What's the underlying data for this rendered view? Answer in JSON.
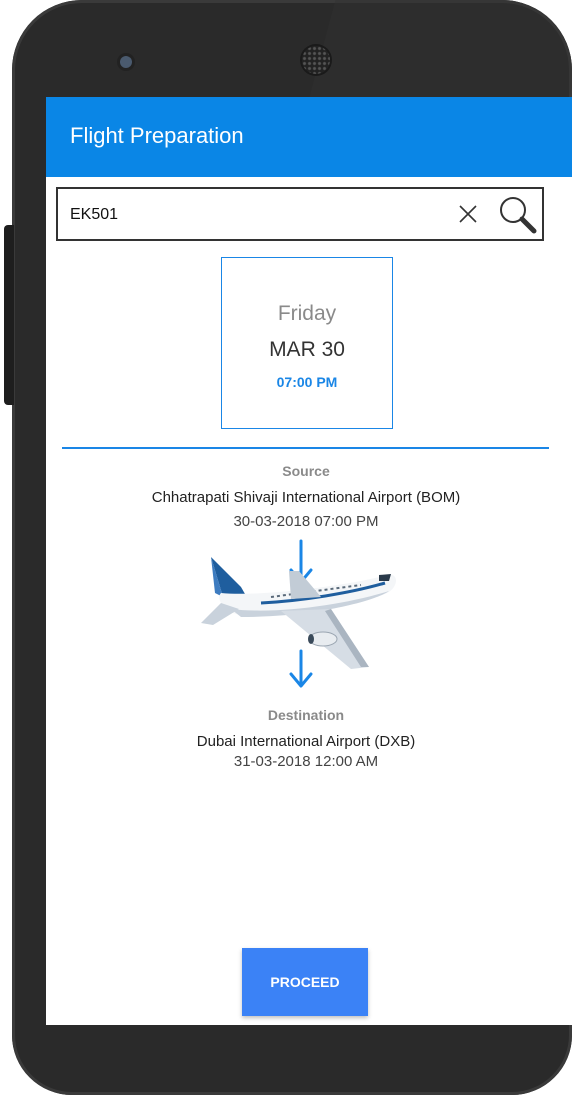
{
  "app": {
    "title": "Flight Preparation"
  },
  "search": {
    "value": "EK501"
  },
  "flight_date": {
    "day": "Friday",
    "date": "MAR 30",
    "time": "07:00 PM"
  },
  "source": {
    "label": "Source",
    "airport": "Chhatrapati Shivaji International Airport (BOM)",
    "datetime": "30-03-2018 07:00 PM"
  },
  "destination": {
    "label": "Destination",
    "airport": "Dubai International Airport (DXB)",
    "datetime": "31-03-2018 12:00 AM"
  },
  "actions": {
    "proceed_label": "PROCEED"
  },
  "colors": {
    "accent": "#0a86e6",
    "button": "#3b82f6",
    "arrow": "#1a86e6"
  },
  "icons": [
    "clear-icon",
    "search-icon",
    "arrow-down-icon",
    "airplane-icon"
  ]
}
